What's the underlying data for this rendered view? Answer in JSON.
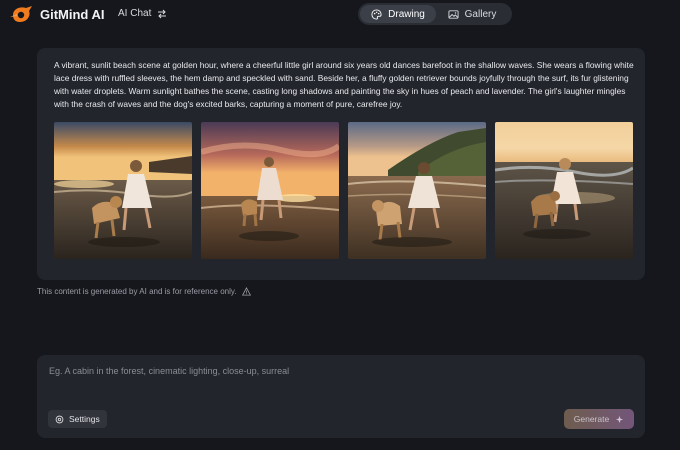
{
  "header": {
    "brand": "GitMind AI",
    "ai_chat_label": "AI Chat",
    "tabs": [
      {
        "label": "Drawing",
        "icon": "palette-icon",
        "active": true
      },
      {
        "label": "Gallery",
        "icon": "image-icon",
        "active": false
      }
    ]
  },
  "result": {
    "prompt": "A vibrant, sunlit beach scene at golden hour, where a cheerful little girl around six years old dances barefoot in the shallow waves. She wears a flowing white lace dress with ruffled sleeves, the hem damp and speckled with sand. Beside her, a fluffy golden retriever bounds joyfully through the surf, its fur glistening with water droplets. Warm sunlight bathes the scene, casting long shadows and painting the sky in hues of peach and lavender. The girl's laughter mingles with the crash of waves and the dog's excited barks, capturing a moment of pure, carefree joy.",
    "images": [
      {
        "name": "generated-image-1"
      },
      {
        "name": "generated-image-2"
      },
      {
        "name": "generated-image-3"
      },
      {
        "name": "generated-image-4"
      }
    ]
  },
  "disclaimer": "This content is generated by AI and is for reference only.",
  "composer": {
    "placeholder": "Eg. A cabin in the forest, cinematic lighting, close-up, surreal",
    "value": "",
    "settings_label": "Settings",
    "generate_label": "Generate"
  },
  "colors": {
    "background": "#15171c",
    "panel": "#22252c",
    "brand_orange": "#f07c1e"
  }
}
